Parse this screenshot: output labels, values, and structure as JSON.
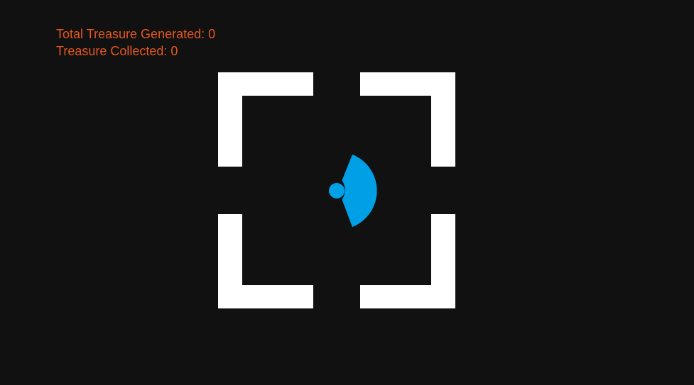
{
  "hud": {
    "total_generated_label": "Total Treasure Generated:",
    "total_generated_value": "0",
    "collected_label": "Treasure Collected:",
    "collected_value": "0"
  },
  "colors": {
    "background": "#111111",
    "walls": "#ffffff",
    "player": "#00a0e6",
    "hud_text": "#e5581f"
  },
  "player": {
    "facing": "right",
    "vision": "cone"
  }
}
